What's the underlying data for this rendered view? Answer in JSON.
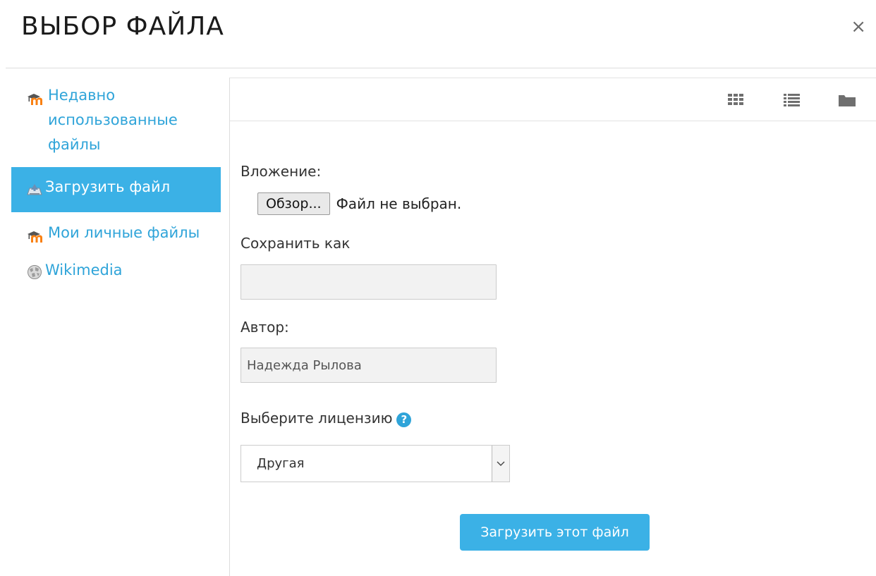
{
  "dialog": {
    "title": "ВЫБОР ФАЙЛА",
    "close_label": "×"
  },
  "sidebar": {
    "items": [
      {
        "label": "Недавно использованные файлы",
        "icon": "moodle-icon",
        "active": false
      },
      {
        "label": "Загрузить файл",
        "icon": "upload-icon",
        "active": true
      },
      {
        "label": "Мои личные файлы",
        "icon": "moodle-icon",
        "active": false
      },
      {
        "label": "Wikimedia",
        "icon": "wikimedia-globe-icon",
        "active": false
      }
    ]
  },
  "toolbar": {
    "views": [
      "grid-view-icon",
      "list-view-icon",
      "folder-view-icon"
    ]
  },
  "form": {
    "attachment_label": "Вложение:",
    "browse_button": "Обзор...",
    "file_status": "Файл не выбран.",
    "save_as_label": "Сохранить как",
    "save_as_value": "",
    "author_label": "Автор:",
    "author_value": "Надежда Рылова",
    "license_label": "Выберите лицензию",
    "license_help": "?",
    "license_selected": "Другая",
    "submit_label": "Загрузить этот файл"
  },
  "colors": {
    "accent": "#3bb1e6",
    "link": "#2fa4d9",
    "moodle_orange": "#f98012"
  }
}
